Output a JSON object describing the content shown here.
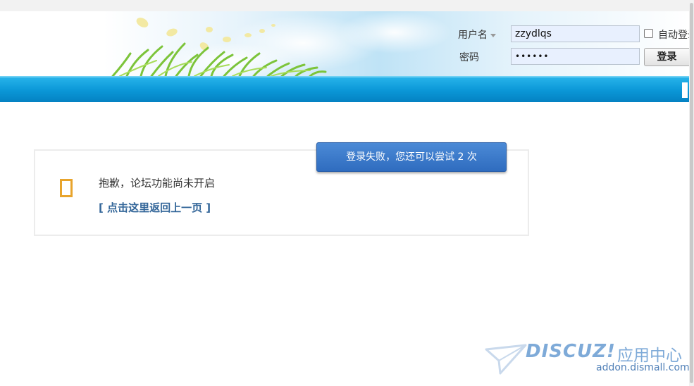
{
  "header": {
    "login": {
      "username_label": "用户名",
      "password_label": "密码",
      "username_value": "zzydlqs",
      "password_mask": "••••••",
      "remember_label": "自动登录",
      "login_button": "登录"
    }
  },
  "message": {
    "text": "抱歉，论坛功能尚未开启",
    "back_link": "[ 点击这里返回上一页 ]"
  },
  "toast": {
    "text": "登录失败，您还可以尝试 2 次"
  },
  "watermark": {
    "logo": "DISCUZ!",
    "cn_text": "应用中心",
    "url": "addon.dismall.com"
  },
  "icons": {
    "alert": "alert-icon",
    "caret": "caret-down-icon",
    "plane": "paper-plane-icon"
  },
  "colors": {
    "nav_bar": "#0a96d6",
    "link": "#336699",
    "toast": "#3a78c8",
    "alert_icon": "#e8a42c"
  }
}
